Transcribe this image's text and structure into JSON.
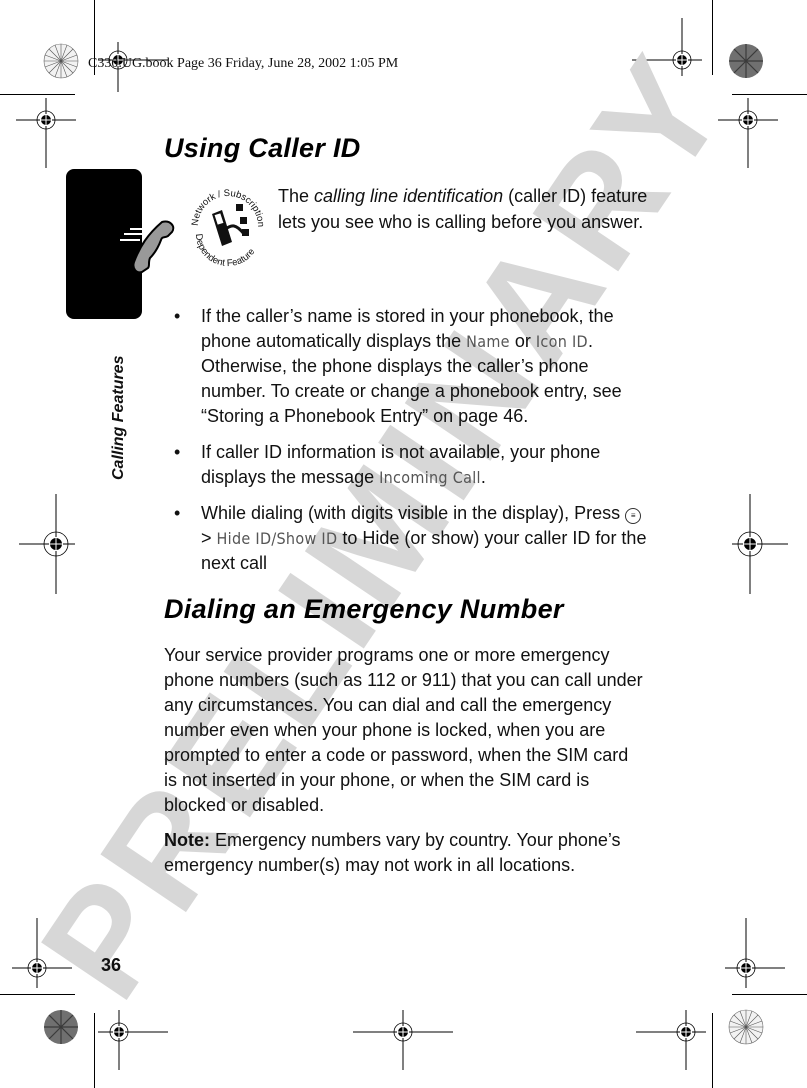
{
  "header_stamp": "C330.UG.book  Page 36  Friday, June 28, 2002  1:05 PM",
  "watermark": "PRELIMINARY",
  "side_tab": {
    "label": "Calling Features",
    "icon": "phone-handset-icon"
  },
  "section1": {
    "title": "Using Caller ID",
    "badge_icon": "network-subscription-dependent-feature-icon",
    "badge_text_top": "Network / Subscription",
    "badge_text_bottom": "Dependent Feature",
    "intro_pre": "The ",
    "intro_em": "calling line identification",
    "intro_post": " (caller ID) feature lets you see who is calling before you answer.",
    "bullets": [
      {
        "pre": "If the caller’s name is stored in your phonebook, the phone automatically displays the ",
        "disp1": "Name",
        "mid": " or ",
        "disp2": "Icon ID",
        "post": ". Otherwise, the phone displays the caller’s phone number. To create or change a phonebook entry, see “Storing a Phonebook Entry” on page 46."
      },
      {
        "pre": "If caller ID information is not available, your phone displays the message ",
        "disp1": "Incoming Call",
        "post": "."
      },
      {
        "pre": "While dialing (with digits visible in the display), Press ",
        "key_icon": "menu-key-icon",
        "sep": " > ",
        "disp1": "Hide ID/Show ID",
        "post": " to Hide (or show) your caller ID for the next call"
      }
    ]
  },
  "section2": {
    "title": "Dialing an Emergency Number",
    "body": "Your service provider programs one or more emergency phone numbers (such as 112 or 911) that you can call under any circumstances. You can dial and call the emergency number even when your phone is locked, when you are prompted to enter a code or password, when the SIM card is not inserted in your phone, or when the SIM card is blocked or disabled.",
    "note_label": "Note:",
    "note_text": " Emergency numbers vary by country. Your phone’s emergency number(s) may not work in all locations."
  },
  "page_number": "36"
}
